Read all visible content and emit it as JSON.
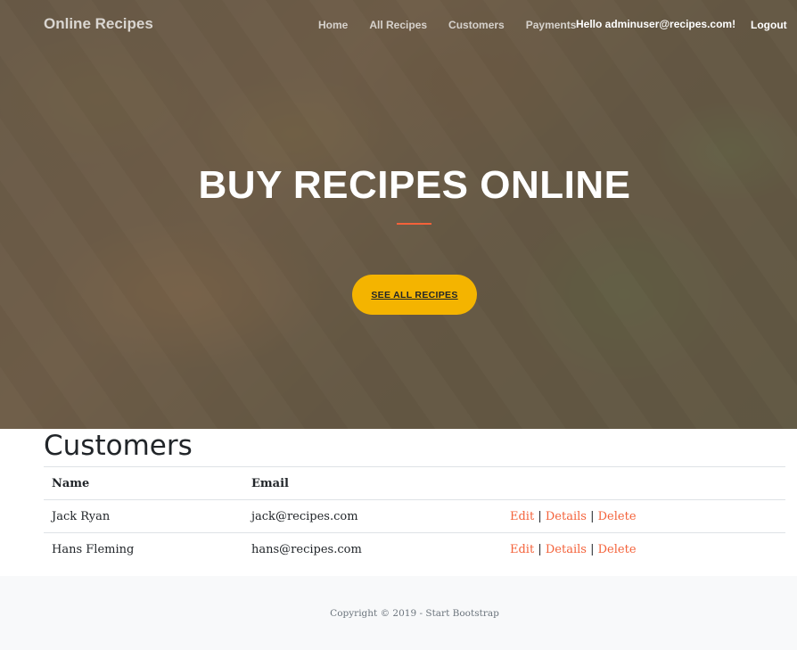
{
  "navbar": {
    "brand": "Online Recipes",
    "links": [
      "Home",
      "All Recipes",
      "Customers",
      "Payments"
    ],
    "greeting": "Hello adminuser@recipes.com!",
    "logout": "Logout"
  },
  "hero": {
    "title": "BUY RECIPES ONLINE",
    "button": "SEE ALL RECIPES"
  },
  "customers": {
    "title": "Customers",
    "columns": [
      "Name",
      "Email",
      ""
    ],
    "rows": [
      {
        "name": "Jack Ryan",
        "email": "jack@recipes.com"
      },
      {
        "name": "Hans Fleming",
        "email": "hans@recipes.com"
      }
    ],
    "actions": {
      "edit": "Edit",
      "details": "Details",
      "delete": "Delete",
      "separator": "|"
    }
  },
  "footer": {
    "copyright": "Copyright © 2019 - Start Bootstrap"
  },
  "colors": {
    "accent": "#f4623a",
    "button": "#f4b400",
    "footer_bg": "#f8f9fa"
  }
}
